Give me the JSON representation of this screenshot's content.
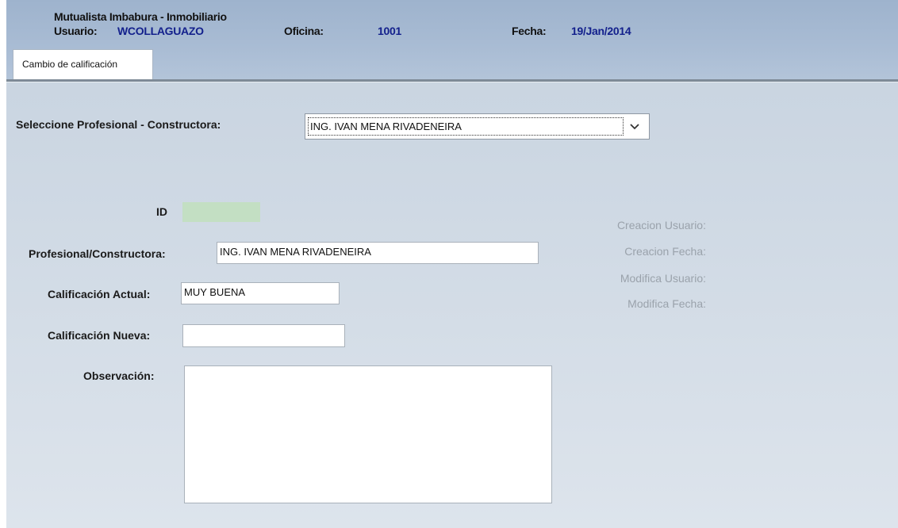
{
  "header": {
    "app_title": "Mutualista Imbabura - Inmobiliario",
    "usuario_label": "Usuario:",
    "usuario_value": "WCOLLAGUAZO",
    "oficina_label": "Oficina:",
    "oficina_value": "1001",
    "fecha_label": "Fecha:",
    "fecha_value": "19/Jan/2014"
  },
  "tabs": [
    {
      "label": "Cambio de calificación"
    }
  ],
  "form": {
    "select_label": "Seleccione Profesional - Constructora:",
    "select_value": "ING. IVAN MENA RIVADENEIRA",
    "id_label": "ID",
    "id_value": "",
    "profesional_label": "Profesional/Constructora:",
    "profesional_value": "ING. IVAN MENA RIVADENEIRA",
    "calificacion_actual_label": "Calificación Actual:",
    "calificacion_actual_value": "MUY BUENA",
    "calificacion_nueva_label": "Calificación Nueva:",
    "calificacion_nueva_value": "",
    "observacion_label": "Observación:",
    "observacion_value": ""
  },
  "audit": {
    "creacion_usuario_label": "Creacion Usuario:",
    "creacion_fecha_label": "Creacion Fecha:",
    "modifica_usuario_label": "Modifica Usuario:",
    "modifica_fecha_label": "Modifica Fecha:"
  },
  "icons": {
    "dropdown": "chevron-down-icon"
  },
  "colors": {
    "header_bg": "#a9bcd4",
    "header_value_text": "#13208c",
    "id_field_bg": "#c3dfc3",
    "audit_label_text": "#9aa2ab"
  }
}
